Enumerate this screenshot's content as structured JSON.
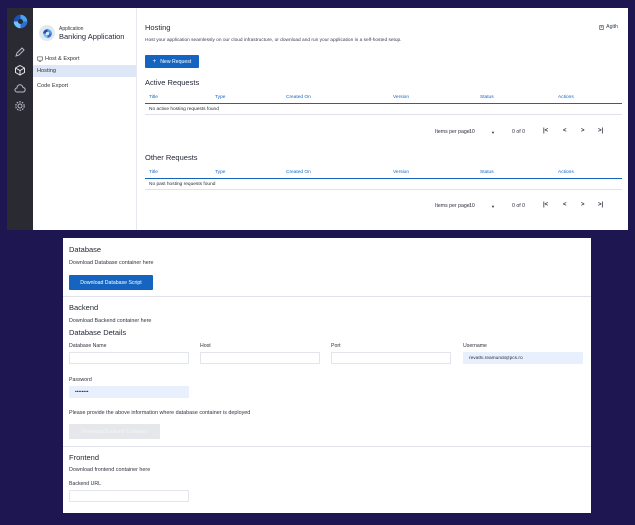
{
  "sidebar": {
    "app_caption": "Application",
    "app_name": "Banking Application",
    "group_label": "Host & Export",
    "items": [
      {
        "label": "Hosting",
        "active": true
      },
      {
        "label": "Code Export",
        "active": false
      }
    ]
  },
  "rail_icons": [
    "app-logo-icon",
    "pencil-icon",
    "cube-icon",
    "cloud-icon",
    "gear-icon"
  ],
  "hosting": {
    "title": "Hosting",
    "help_label": "Agith",
    "description": "Host your application seamlessly on our cloud infrastructure, or download and run your application in a self-hosted setup.",
    "new_request_label": "New Request"
  },
  "tables": {
    "columns": [
      "Title",
      "Type",
      "Created On",
      "Version",
      "Status",
      "Actions"
    ],
    "active": {
      "title": "Active Requests",
      "empty_message": "No active hosting requests found",
      "items_per_page_label": "Items per page:",
      "items_per_page_value": "10",
      "range": "0 of 0"
    },
    "other": {
      "title": "Other Requests",
      "empty_message": "No past hosting requests found",
      "items_per_page_label": "Items per page:",
      "items_per_page_value": "10",
      "range": "0 of 0"
    }
  },
  "database": {
    "title": "Database",
    "description": "Download Database container here",
    "button_label": "Download Database Script"
  },
  "backend": {
    "title": "Backend",
    "description": "Download Backend container here",
    "details_title": "Database Details",
    "fields": {
      "db_name_label": "Database Name",
      "db_name_value": "",
      "host_label": "Host",
      "host_value": "",
      "port_label": "Port",
      "port_value": "",
      "username_label": "Username",
      "username_value": "revathi.reamundi@pcs.ro",
      "password_label": "Password",
      "password_value": "••••••••"
    },
    "info_text": "Please provide the above information where database container is deployed",
    "download_button_label": "Download Backend Container"
  },
  "frontend": {
    "title": "Frontend",
    "description": "Download frontend container here",
    "backend_url_label": "Backend URL",
    "backend_url_value": ""
  },
  "colors": {
    "accent": "#1565c0",
    "page_background": "#1d1650",
    "rail_background": "#2a2a33",
    "active_nav": "#dde7f7",
    "filled_input": "#e8f0fe"
  }
}
